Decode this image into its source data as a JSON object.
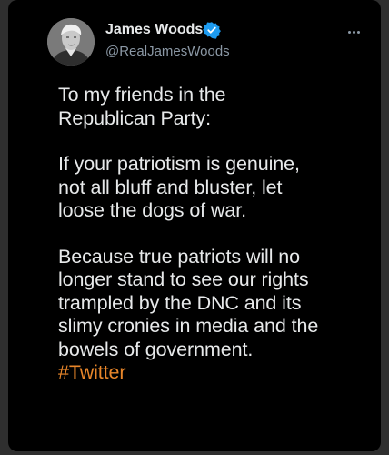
{
  "author": {
    "display_name": "James Woods",
    "handle": "@RealJamesWoods",
    "verified": true
  },
  "tweet": {
    "paragraph_1_lines": [
      "To my friends in the",
      "Republican Party:"
    ],
    "paragraph_2_lines": [
      "If your patriotism is genuine,",
      "not all bluff and bluster, let",
      "loose the dogs of war."
    ],
    "paragraph_3_lines": [
      "Because true patriots will no",
      "longer stand to see our rights",
      "trampled by the DNC and its",
      "slimy cronies in media and the",
      "bowels of government."
    ],
    "hashtag": "#Twitter"
  },
  "icons": {
    "verified": "verified-badge-icon",
    "more": "more-options-icon"
  },
  "colors": {
    "background": "#000000",
    "text": "#e7e9ea",
    "secondary_text": "#8b98a5",
    "verified": "#1d9bf0",
    "hashtag": "#e8862a"
  }
}
